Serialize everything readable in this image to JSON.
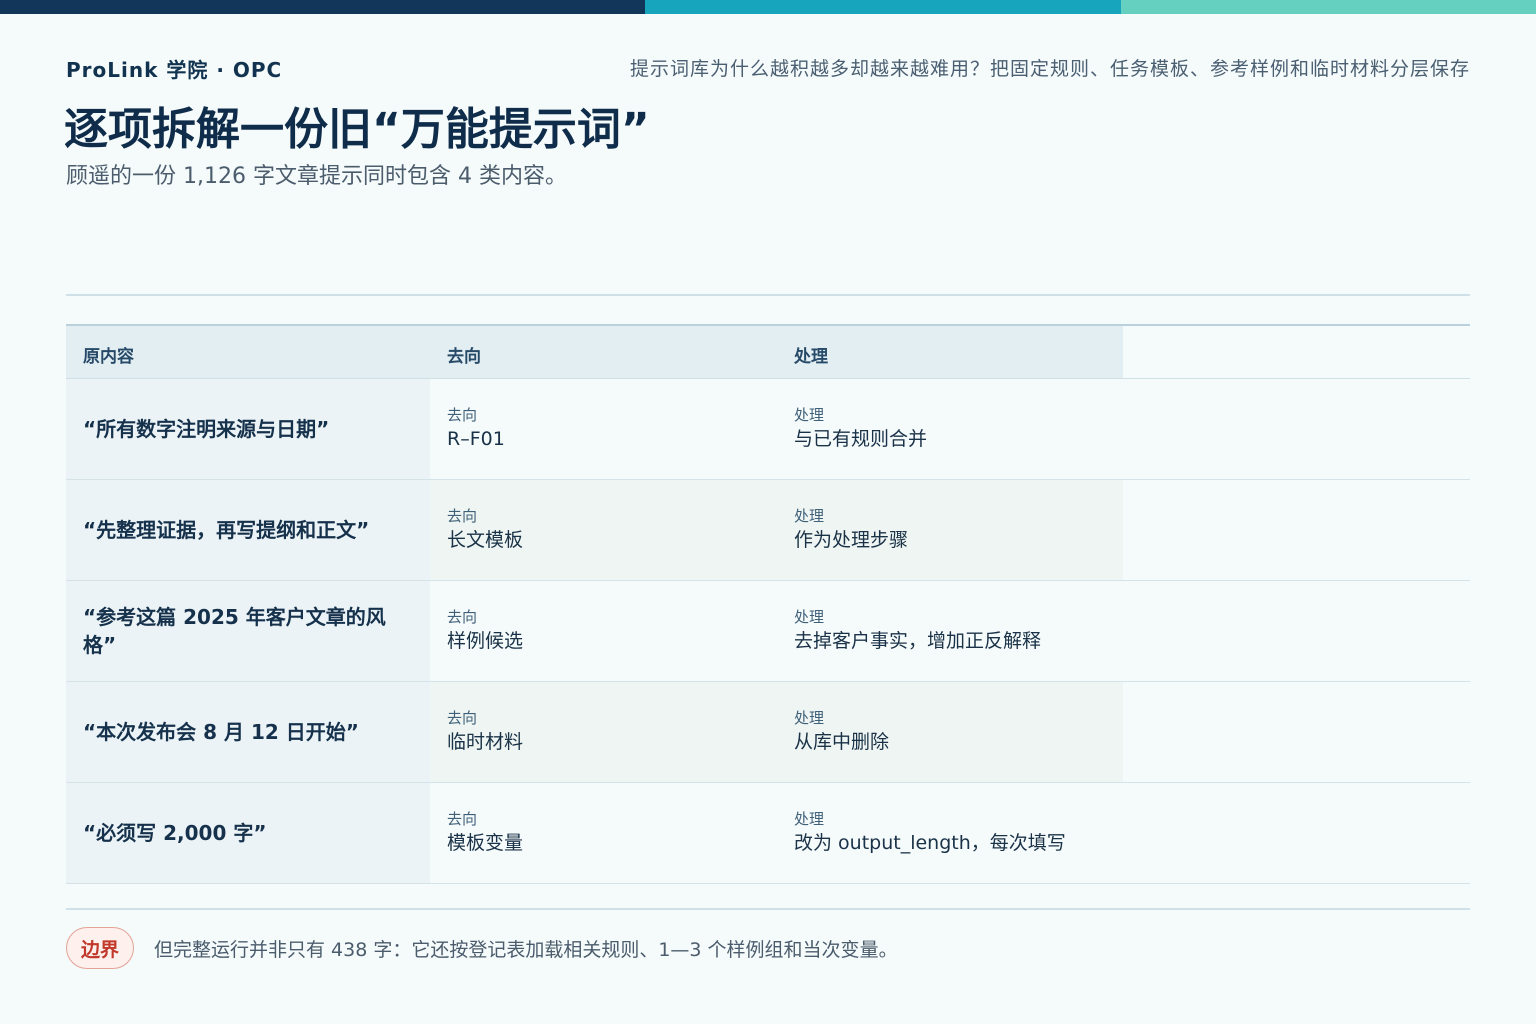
{
  "colors": {
    "bar_dark": "#12365a",
    "bar_teal": "#17a5bd",
    "bar_mint": "#66d0c0",
    "accent_red": "#c0392b"
  },
  "header": {
    "brand": "ProLink 学院 · OPC",
    "tagline": "提示词库为什么越积越多却越来越难用？把固定规则、任务模板、参考样例和临时材料分层保存",
    "title": "逐项拆解一份旧“万能提示词”",
    "subtitle": "顾遥的一份 1,126 字文章提示同时包含 4 类内容。"
  },
  "table": {
    "headers": [
      "原内容",
      "去向",
      "处理"
    ],
    "rows": [
      {
        "original": "“所有数字注明来源与日期”",
        "dest_label": "去向",
        "dest": "R–F01",
        "action_label": "处理",
        "action": "与已有规则合并"
      },
      {
        "original": "“先整理证据，再写提纲和正文”",
        "dest_label": "去向",
        "dest": "长文模板",
        "action_label": "处理",
        "action": "作为处理步骤"
      },
      {
        "original": "“参考这篇 2025 年客户文章的风格”",
        "dest_label": "去向",
        "dest": "样例候选",
        "action_label": "处理",
        "action": "去掉客户事实，增加正反解释"
      },
      {
        "original": "“本次发布会 8 月 12 日开始”",
        "dest_label": "去向",
        "dest": "临时材料",
        "action_label": "处理",
        "action": "从库中删除"
      },
      {
        "original": "“必须写 2,000 字”",
        "dest_label": "去向",
        "dest": "模板变量",
        "action_label": "处理",
        "action": "改为 output_length，每次填写"
      }
    ]
  },
  "note": {
    "badge": "边界",
    "text": "但完整运行并非只有 438 字：它还按登记表加载相关规则、1—3 个样例组和当次变量。"
  }
}
